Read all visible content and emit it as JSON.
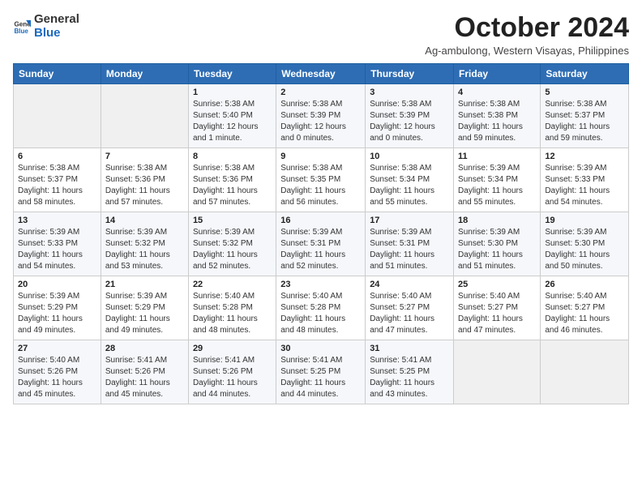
{
  "header": {
    "logo_general": "General",
    "logo_blue": "Blue",
    "month_title": "October 2024",
    "location": "Ag-ambulong, Western Visayas, Philippines"
  },
  "days_of_week": [
    "Sunday",
    "Monday",
    "Tuesday",
    "Wednesday",
    "Thursday",
    "Friday",
    "Saturday"
  ],
  "weeks": [
    [
      {
        "day": "",
        "info": ""
      },
      {
        "day": "",
        "info": ""
      },
      {
        "day": "1",
        "info": "Sunrise: 5:38 AM\nSunset: 5:40 PM\nDaylight: 12 hours\nand 1 minute."
      },
      {
        "day": "2",
        "info": "Sunrise: 5:38 AM\nSunset: 5:39 PM\nDaylight: 12 hours\nand 0 minutes."
      },
      {
        "day": "3",
        "info": "Sunrise: 5:38 AM\nSunset: 5:39 PM\nDaylight: 12 hours\nand 0 minutes."
      },
      {
        "day": "4",
        "info": "Sunrise: 5:38 AM\nSunset: 5:38 PM\nDaylight: 11 hours\nand 59 minutes."
      },
      {
        "day": "5",
        "info": "Sunrise: 5:38 AM\nSunset: 5:37 PM\nDaylight: 11 hours\nand 59 minutes."
      }
    ],
    [
      {
        "day": "6",
        "info": "Sunrise: 5:38 AM\nSunset: 5:37 PM\nDaylight: 11 hours\nand 58 minutes."
      },
      {
        "day": "7",
        "info": "Sunrise: 5:38 AM\nSunset: 5:36 PM\nDaylight: 11 hours\nand 57 minutes."
      },
      {
        "day": "8",
        "info": "Sunrise: 5:38 AM\nSunset: 5:36 PM\nDaylight: 11 hours\nand 57 minutes."
      },
      {
        "day": "9",
        "info": "Sunrise: 5:38 AM\nSunset: 5:35 PM\nDaylight: 11 hours\nand 56 minutes."
      },
      {
        "day": "10",
        "info": "Sunrise: 5:38 AM\nSunset: 5:34 PM\nDaylight: 11 hours\nand 55 minutes."
      },
      {
        "day": "11",
        "info": "Sunrise: 5:39 AM\nSunset: 5:34 PM\nDaylight: 11 hours\nand 55 minutes."
      },
      {
        "day": "12",
        "info": "Sunrise: 5:39 AM\nSunset: 5:33 PM\nDaylight: 11 hours\nand 54 minutes."
      }
    ],
    [
      {
        "day": "13",
        "info": "Sunrise: 5:39 AM\nSunset: 5:33 PM\nDaylight: 11 hours\nand 54 minutes."
      },
      {
        "day": "14",
        "info": "Sunrise: 5:39 AM\nSunset: 5:32 PM\nDaylight: 11 hours\nand 53 minutes."
      },
      {
        "day": "15",
        "info": "Sunrise: 5:39 AM\nSunset: 5:32 PM\nDaylight: 11 hours\nand 52 minutes."
      },
      {
        "day": "16",
        "info": "Sunrise: 5:39 AM\nSunset: 5:31 PM\nDaylight: 11 hours\nand 52 minutes."
      },
      {
        "day": "17",
        "info": "Sunrise: 5:39 AM\nSunset: 5:31 PM\nDaylight: 11 hours\nand 51 minutes."
      },
      {
        "day": "18",
        "info": "Sunrise: 5:39 AM\nSunset: 5:30 PM\nDaylight: 11 hours\nand 51 minutes."
      },
      {
        "day": "19",
        "info": "Sunrise: 5:39 AM\nSunset: 5:30 PM\nDaylight: 11 hours\nand 50 minutes."
      }
    ],
    [
      {
        "day": "20",
        "info": "Sunrise: 5:39 AM\nSunset: 5:29 PM\nDaylight: 11 hours\nand 49 minutes."
      },
      {
        "day": "21",
        "info": "Sunrise: 5:39 AM\nSunset: 5:29 PM\nDaylight: 11 hours\nand 49 minutes."
      },
      {
        "day": "22",
        "info": "Sunrise: 5:40 AM\nSunset: 5:28 PM\nDaylight: 11 hours\nand 48 minutes."
      },
      {
        "day": "23",
        "info": "Sunrise: 5:40 AM\nSunset: 5:28 PM\nDaylight: 11 hours\nand 48 minutes."
      },
      {
        "day": "24",
        "info": "Sunrise: 5:40 AM\nSunset: 5:27 PM\nDaylight: 11 hours\nand 47 minutes."
      },
      {
        "day": "25",
        "info": "Sunrise: 5:40 AM\nSunset: 5:27 PM\nDaylight: 11 hours\nand 47 minutes."
      },
      {
        "day": "26",
        "info": "Sunrise: 5:40 AM\nSunset: 5:27 PM\nDaylight: 11 hours\nand 46 minutes."
      }
    ],
    [
      {
        "day": "27",
        "info": "Sunrise: 5:40 AM\nSunset: 5:26 PM\nDaylight: 11 hours\nand 45 minutes."
      },
      {
        "day": "28",
        "info": "Sunrise: 5:41 AM\nSunset: 5:26 PM\nDaylight: 11 hours\nand 45 minutes."
      },
      {
        "day": "29",
        "info": "Sunrise: 5:41 AM\nSunset: 5:26 PM\nDaylight: 11 hours\nand 44 minutes."
      },
      {
        "day": "30",
        "info": "Sunrise: 5:41 AM\nSunset: 5:25 PM\nDaylight: 11 hours\nand 44 minutes."
      },
      {
        "day": "31",
        "info": "Sunrise: 5:41 AM\nSunset: 5:25 PM\nDaylight: 11 hours\nand 43 minutes."
      },
      {
        "day": "",
        "info": ""
      },
      {
        "day": "",
        "info": ""
      }
    ]
  ]
}
